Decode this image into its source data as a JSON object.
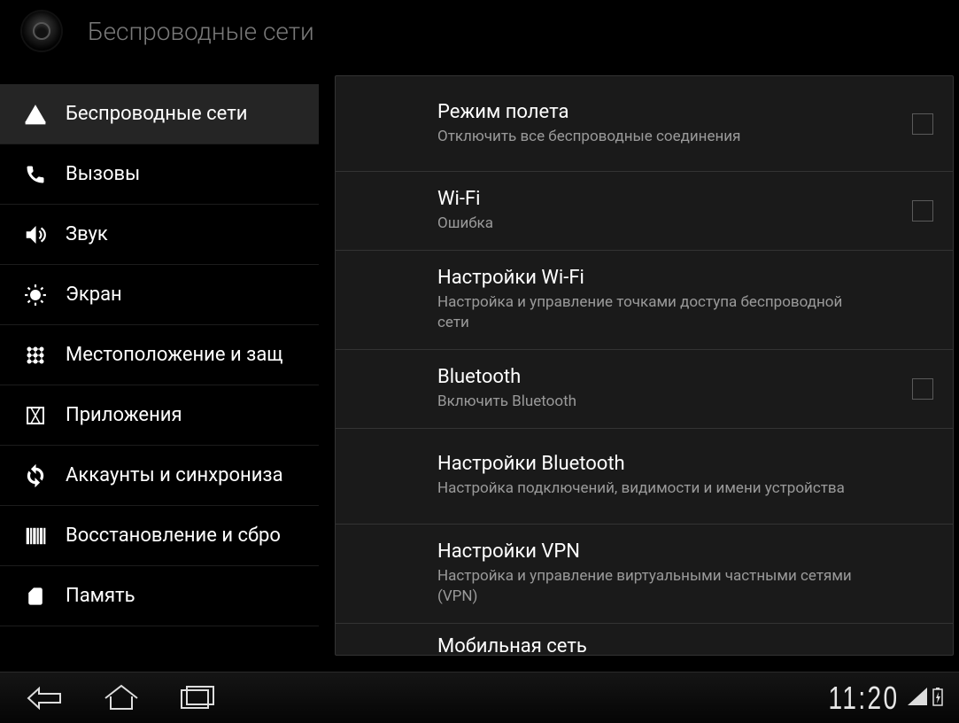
{
  "header": {
    "title": "Беспроводные сети"
  },
  "sidebar": {
    "items": [
      {
        "id": "wireless",
        "label": "Беспроводные сети",
        "icon": "signal-icon",
        "selected": true
      },
      {
        "id": "calls",
        "label": "Вызовы",
        "icon": "phone-icon",
        "selected": false
      },
      {
        "id": "sound",
        "label": "Звук",
        "icon": "speaker-icon",
        "selected": false
      },
      {
        "id": "display",
        "label": "Экран",
        "icon": "brightness-icon",
        "selected": false
      },
      {
        "id": "location",
        "label": "Местоположение и защ",
        "icon": "grid-icon",
        "selected": false
      },
      {
        "id": "apps",
        "label": "Приложения",
        "icon": "apps-icon",
        "selected": false
      },
      {
        "id": "accounts",
        "label": "Аккаунты и синхрониза",
        "icon": "sync-icon",
        "selected": false
      },
      {
        "id": "backup",
        "label": "Восстановление и сбро",
        "icon": "barcode-icon",
        "selected": false
      },
      {
        "id": "storage",
        "label": "Память",
        "icon": "sd-icon",
        "selected": false
      }
    ]
  },
  "content": {
    "rows": [
      {
        "id": "airplane",
        "title": "Режим полета",
        "sub": "Отключить все беспроводные соединения",
        "checkbox": true
      },
      {
        "id": "wifi",
        "title": "Wi-Fi",
        "sub": "Ошибка",
        "checkbox": true
      },
      {
        "id": "wifi-settings",
        "title": "Настройки Wi-Fi",
        "sub": "Настройка и управление точками доступа беспроводной сети",
        "checkbox": false
      },
      {
        "id": "bluetooth",
        "title": "Bluetooth",
        "sub": "Включить Bluetooth",
        "checkbox": true
      },
      {
        "id": "bt-settings",
        "title": "Настройки Bluetooth",
        "sub": "Настройка подключений, видимости и имени устройства",
        "checkbox": false
      },
      {
        "id": "vpn",
        "title": "Настройки VPN",
        "sub": "Настройка и управление виртуальными частными сетями (VPN)",
        "checkbox": false
      },
      {
        "id": "mobile",
        "title": "Мобильная сеть",
        "sub": "",
        "checkbox": false
      }
    ]
  },
  "navbar": {
    "time": "11:20"
  }
}
